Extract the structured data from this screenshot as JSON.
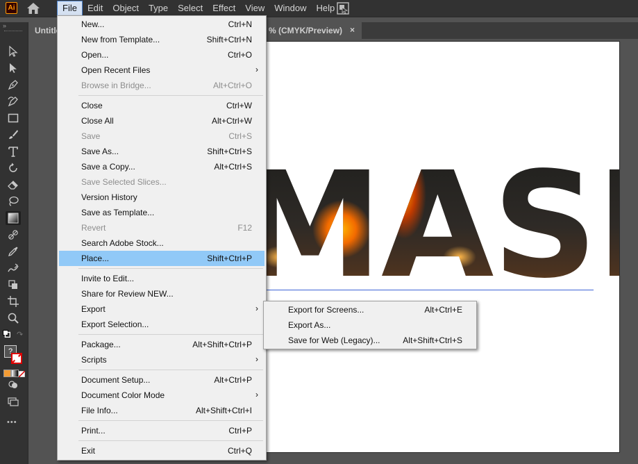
{
  "menubar": {
    "app_logo": "Ai",
    "items": [
      "File",
      "Edit",
      "Object",
      "Type",
      "Select",
      "Effect",
      "View",
      "Window",
      "Help"
    ]
  },
  "document": {
    "tab_title_left": "Untitle",
    "tab_title_right": "% (CMYK/Preview)",
    "close": "×"
  },
  "canvas": {
    "artwork_text": "MASK"
  },
  "file_menu": {
    "items": [
      {
        "label": "New...",
        "shortcut": "Ctrl+N",
        "disabled": false
      },
      {
        "label": "New from Template...",
        "shortcut": "Shift+Ctrl+N",
        "disabled": false
      },
      {
        "label": "Open...",
        "shortcut": "Ctrl+O",
        "disabled": false
      },
      {
        "label": "Open Recent Files",
        "shortcut": "",
        "submenu": true,
        "disabled": false
      },
      {
        "label": "Browse in Bridge...",
        "shortcut": "Alt+Ctrl+O",
        "disabled": true
      },
      {
        "label": "Close",
        "shortcut": "Ctrl+W",
        "disabled": false
      },
      {
        "label": "Close All",
        "shortcut": "Alt+Ctrl+W",
        "disabled": false
      },
      {
        "label": "Save",
        "shortcut": "Ctrl+S",
        "disabled": true
      },
      {
        "label": "Save As...",
        "shortcut": "Shift+Ctrl+S",
        "disabled": false
      },
      {
        "label": "Save a Copy...",
        "shortcut": "Alt+Ctrl+S",
        "disabled": false
      },
      {
        "label": "Save Selected Slices...",
        "shortcut": "",
        "disabled": true
      },
      {
        "label": "Version History",
        "shortcut": "",
        "disabled": false
      },
      {
        "label": "Save as Template...",
        "shortcut": "",
        "disabled": false
      },
      {
        "label": "Revert",
        "shortcut": "F12",
        "disabled": true
      },
      {
        "label": "Search Adobe Stock...",
        "shortcut": "",
        "disabled": false
      },
      {
        "label": "Place...",
        "shortcut": "Shift+Ctrl+P",
        "disabled": false,
        "highlighted": true
      },
      {
        "label": "Invite to Edit...",
        "shortcut": "",
        "disabled": false
      },
      {
        "label": "Share for Review NEW...",
        "shortcut": "",
        "disabled": false
      },
      {
        "label": "Export",
        "shortcut": "",
        "submenu": true,
        "disabled": false
      },
      {
        "label": "Export Selection...",
        "shortcut": "",
        "disabled": false
      },
      {
        "label": "Package...",
        "shortcut": "Alt+Shift+Ctrl+P",
        "disabled": false
      },
      {
        "label": "Scripts",
        "shortcut": "",
        "submenu": true,
        "disabled": false
      },
      {
        "label": "Document Setup...",
        "shortcut": "Alt+Ctrl+P",
        "disabled": false
      },
      {
        "label": "Document Color Mode",
        "shortcut": "",
        "submenu": true,
        "disabled": false
      },
      {
        "label": "File Info...",
        "shortcut": "Alt+Shift+Ctrl+I",
        "disabled": false
      },
      {
        "label": "Print...",
        "shortcut": "Ctrl+P",
        "disabled": false
      },
      {
        "label": "Exit",
        "shortcut": "Ctrl+Q",
        "disabled": false
      }
    ],
    "submenu_arrow": "›"
  },
  "export_submenu": {
    "items": [
      {
        "label": "Export for Screens...",
        "shortcut": "Alt+Ctrl+E"
      },
      {
        "label": "Export As...",
        "shortcut": ""
      },
      {
        "label": "Save for Web (Legacy)...",
        "shortcut": "Alt+Shift+Ctrl+S"
      }
    ]
  },
  "toolbar": {
    "tools": [
      "selection-tool-icon",
      "direct-selection-tool-icon",
      "pen-tool-icon",
      "curvature-tool-icon",
      "rectangle-tool-icon",
      "paintbrush-tool-icon",
      "type-tool-icon",
      "rotate-tool-icon",
      "eraser-tool-icon",
      "lasso-tool-icon",
      "gradient-tool-icon",
      "eyedropper-tool-icon",
      "blend-tool-icon",
      "shape-builder-tool-icon",
      "artboard-tool-icon",
      "zoom-tool-icon"
    ],
    "more": "•••",
    "unknown_fill": "?"
  }
}
